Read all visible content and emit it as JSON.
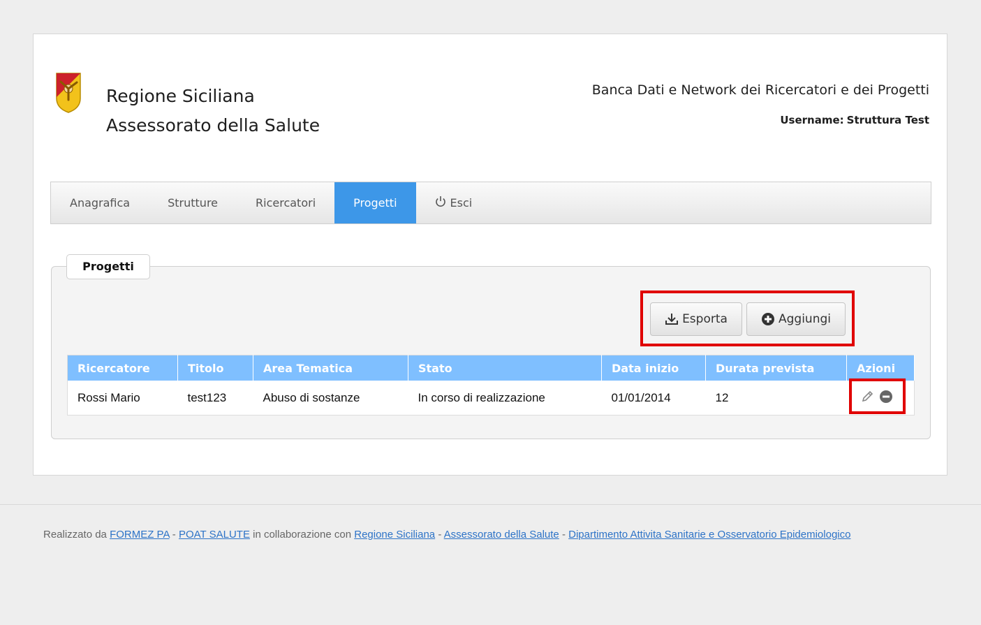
{
  "header": {
    "org_line1": "Regione Siciliana",
    "org_line2": "Assessorato della Salute",
    "app_title": "Banca Dati e Network dei Ricercatori e dei Progetti",
    "username_label": "Username:",
    "username_value": "Struttura Test"
  },
  "nav": {
    "items": [
      {
        "label": "Anagrafica"
      },
      {
        "label": "Strutture"
      },
      {
        "label": "Ricercatori"
      },
      {
        "label": "Progetti",
        "active": true
      },
      {
        "label": "Esci",
        "icon": "power-icon"
      }
    ]
  },
  "panel": {
    "title": "Progetti",
    "export_label": "Esporta",
    "add_label": "Aggiungi"
  },
  "table": {
    "columns": [
      "Ricercatore",
      "Titolo",
      "Area Tematica",
      "Stato",
      "Data inizio",
      "Durata prevista",
      "Azioni"
    ],
    "rows": [
      [
        "Rossi Mario",
        "test123",
        "Abuso di sostanze",
        "In corso di realizzazione",
        "01/01/2014",
        "12"
      ]
    ],
    "row_actions": [
      "edit-icon",
      "remove-icon"
    ]
  },
  "footer": {
    "prefix": "Realizzato da",
    "link1": "FORMEZ PA",
    "sep1": "-",
    "link2": "POAT SALUTE",
    "middle": "in collaborazione con",
    "link3": "Regione Siciliana",
    "sep2": "-",
    "link4": "Assessorato della Salute",
    "sep3": "-",
    "link5": "Dipartimento Attivita Sanitarie e Osservatorio Epidemiologico"
  },
  "colors": {
    "nav_active": "#3d97e8",
    "table_header": "#7fbfff",
    "highlight": "#e00000",
    "link": "#2d73c7"
  }
}
